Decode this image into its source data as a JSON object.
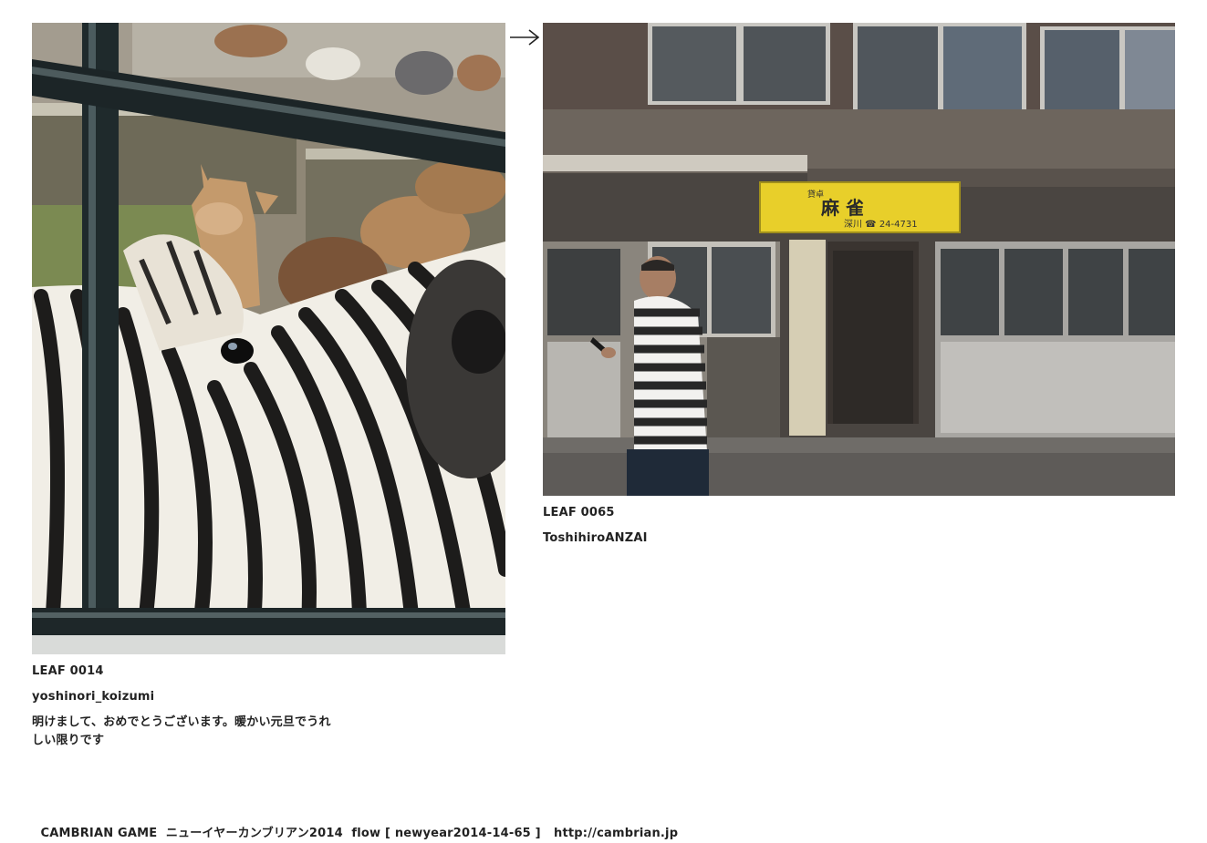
{
  "left_entry": {
    "leaf_id": "LEAF 0014",
    "author": "yoshinori_koizumi",
    "message": "明けまして、おめでとうございます。暖かい元旦でうれしい限りです",
    "photo_icon": "zebra-photo"
  },
  "right_entry": {
    "leaf_id": "LEAF 0065",
    "author": "ToshihiroANZAI",
    "photo_icon": "street-building-photo",
    "sign_text_small": "貸卓",
    "sign_text_main": "麻 雀",
    "sign_text_phone": "深川 ☎ 24-4731"
  },
  "nav": {
    "arrow_icon": "right-arrow-icon"
  },
  "footer": {
    "site_name": "CAMBRIAN GAME",
    "event_name": "ニューイヤーカンブリアン2014",
    "flow_label": "flow [ newyear2014-14-65 ]",
    "url": "http://cambrian.jp"
  },
  "colors": {
    "text": "#222222",
    "sign_yellow": "#e8cf2a",
    "background": "#ffffff"
  }
}
